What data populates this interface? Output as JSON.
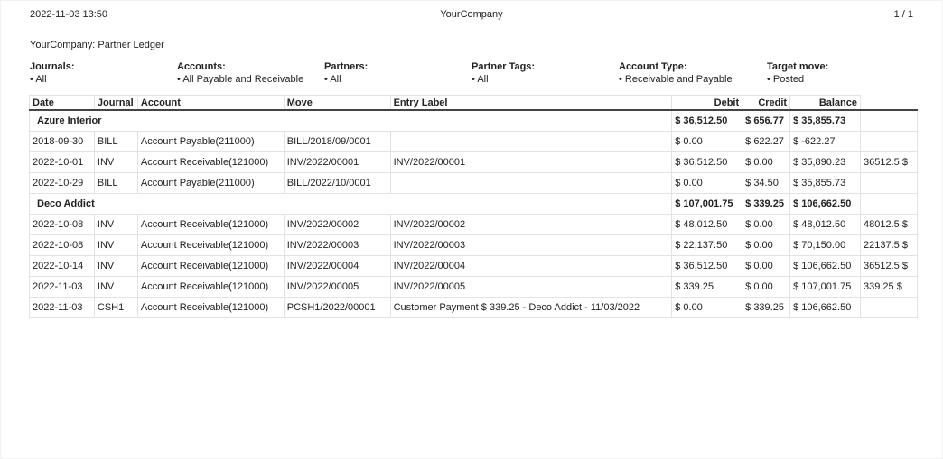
{
  "header": {
    "datetime": "2022-11-03 13:50",
    "company": "YourCompany",
    "pages": "1 / 1"
  },
  "report_title": "YourCompany: Partner Ledger",
  "filters": [
    {
      "label": "Journals:",
      "value": "All"
    },
    {
      "label": "Accounts:",
      "value": "All Payable and Receivable"
    },
    {
      "label": "Partners:",
      "value": "All"
    },
    {
      "label": "Partner Tags:",
      "value": "All"
    },
    {
      "label": "Account Type:",
      "value": "Receivable and Payable"
    },
    {
      "label": "Target move:",
      "value": "Posted"
    }
  ],
  "columns": [
    "Date",
    "Journal",
    "Account",
    "Move",
    "Entry Label",
    "Debit",
    "Credit",
    "Balance"
  ],
  "partners": [
    {
      "name": "Azure Interior",
      "debit": "$ 36,512.50",
      "credit": "$ 656.77",
      "balance": "$ 35,855.73",
      "lines": [
        {
          "date": "2018-09-30",
          "journal": "BILL",
          "account": "Account Payable(211000)",
          "move": "BILL/2018/09/0001",
          "label": "",
          "debit": "$ 0.00",
          "credit": "$ 622.27",
          "balance": "$ -622.27",
          "extra": ""
        },
        {
          "date": "2022-10-01",
          "journal": "INV",
          "account": "Account Receivable(121000)",
          "move": "INV/2022/00001",
          "label": "INV/2022/00001",
          "debit": "$ 36,512.50",
          "credit": "$ 0.00",
          "balance": "$ 35,890.23",
          "extra": "36512.5 $"
        },
        {
          "date": "2022-10-29",
          "journal": "BILL",
          "account": "Account Payable(211000)",
          "move": "BILL/2022/10/0001",
          "label": "",
          "debit": "$ 0.00",
          "credit": "$ 34.50",
          "balance": "$ 35,855.73",
          "extra": ""
        }
      ]
    },
    {
      "name": "Deco Addict",
      "debit": "$ 107,001.75",
      "credit": "$ 339.25",
      "balance": "$ 106,662.50",
      "lines": [
        {
          "date": "2022-10-08",
          "journal": "INV",
          "account": "Account Receivable(121000)",
          "move": "INV/2022/00002",
          "label": "INV/2022/00002",
          "debit": "$ 48,012.50",
          "credit": "$ 0.00",
          "balance": "$ 48,012.50",
          "extra": "48012.5 $"
        },
        {
          "date": "2022-10-08",
          "journal": "INV",
          "account": "Account Receivable(121000)",
          "move": "INV/2022/00003",
          "label": "INV/2022/00003",
          "debit": "$ 22,137.50",
          "credit": "$ 0.00",
          "balance": "$ 70,150.00",
          "extra": "22137.5 $"
        },
        {
          "date": "2022-10-14",
          "journal": "INV",
          "account": "Account Receivable(121000)",
          "move": "INV/2022/00004",
          "label": "INV/2022/00004",
          "debit": "$ 36,512.50",
          "credit": "$ 0.00",
          "balance": "$ 106,662.50",
          "extra": "36512.5 $"
        },
        {
          "date": "2022-11-03",
          "journal": "INV",
          "account": "Account Receivable(121000)",
          "move": "INV/2022/00005",
          "label": "INV/2022/00005",
          "debit": "$ 339.25",
          "credit": "$ 0.00",
          "balance": "$ 107,001.75",
          "extra": "339.25 $"
        },
        {
          "date": "2022-11-03",
          "journal": "CSH1",
          "account": "Account Receivable(121000)",
          "move": "PCSH1/2022/00001",
          "label": "Customer Payment $ 339.25 - Deco Addict - 11/03/2022",
          "debit": "$ 0.00",
          "credit": "$ 339.25",
          "balance": "$ 106,662.50",
          "extra": ""
        }
      ]
    }
  ]
}
